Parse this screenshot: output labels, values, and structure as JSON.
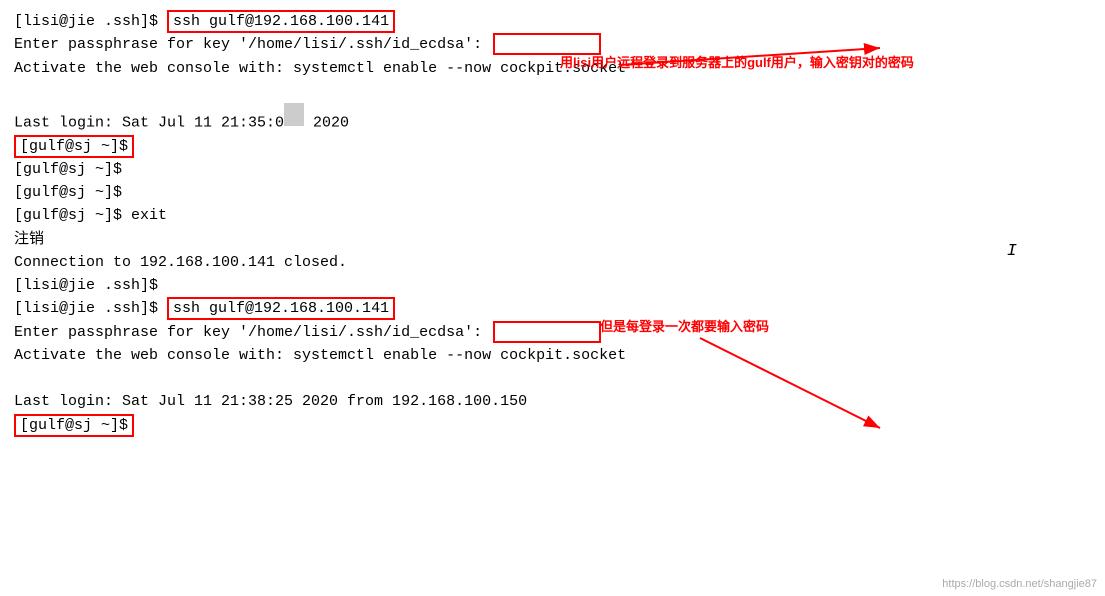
{
  "terminal": {
    "lines": [
      {
        "id": "l1",
        "text": "[lisi@jie .ssh]$ ",
        "cmd": "ssh gulf@192.168.100.141",
        "has_cmd_box": true
      },
      {
        "id": "l2",
        "text": "Enter passphrase for key '/home/lisi/.ssh/id_ecdsa':",
        "has_passphrase_box": true
      },
      {
        "id": "l3",
        "text": "Activate the web console with: systemctl enable --now cockpit.socket"
      },
      {
        "id": "l4",
        "text": ""
      },
      {
        "id": "l5",
        "text": "Last login: Sat Jul 11 21:35:0",
        "suffix": " 2020"
      },
      {
        "id": "l6",
        "text": "[gulf@sj ~]$",
        "has_prompt_box": true
      },
      {
        "id": "l7",
        "text": "[gulf@sj ~]$"
      },
      {
        "id": "l8",
        "text": "[gulf@sj ~]$"
      },
      {
        "id": "l9",
        "text": "[gulf@sj ~]$ exit"
      },
      {
        "id": "l10",
        "text": "注销"
      },
      {
        "id": "l11",
        "text": "Connection to 192.168.100.141 closed."
      },
      {
        "id": "l12",
        "text": "[lisi@jie .ssh]$"
      },
      {
        "id": "l13",
        "text": "[lisi@jie .ssh]$ ",
        "cmd": "ssh gulf@192.168.100.141",
        "has_cmd_box": true
      },
      {
        "id": "l14",
        "text": "Enter passphrase for key '/home/lisi/.ssh/id_ecdsa':",
        "has_passphrase_box": true
      },
      {
        "id": "l15",
        "text": "Activate the web console with: systemctl enable --now cockpit.socket"
      },
      {
        "id": "l16",
        "text": ""
      },
      {
        "id": "l17",
        "text": "Last login: Sat Jul 11 21:38:25 2020 from 192.168.100.150"
      },
      {
        "id": "l18",
        "text": "[gulf@sj ~]$",
        "has_prompt_box": true
      }
    ],
    "annotation1": "用lisi用户远程登录到服务器上的gulf用户，输入密钥对的密码",
    "annotation2": "但是每登录一次都要输入密码",
    "cursor": "I"
  },
  "watermark": "https://blog.csdn.net/shangjie87"
}
